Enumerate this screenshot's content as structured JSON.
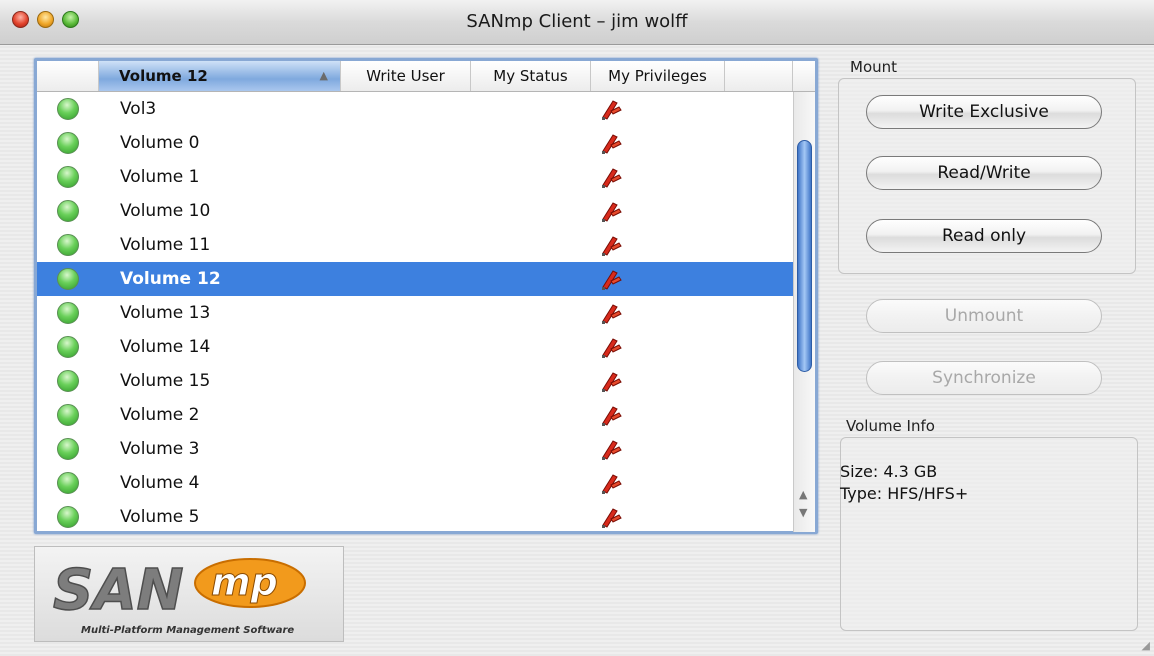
{
  "window": {
    "title": "SANmp Client – jim wolff"
  },
  "table": {
    "columns": {
      "name": "Volume 12",
      "write_user": "Write User",
      "my_status": "My Status",
      "my_privileges": "My Privileges"
    },
    "rows": [
      {
        "name": "Vol3"
      },
      {
        "name": "Volume 0"
      },
      {
        "name": "Volume 1"
      },
      {
        "name": "Volume 10"
      },
      {
        "name": "Volume 11"
      },
      {
        "name": "Volume 12",
        "selected": true
      },
      {
        "name": "Volume 13"
      },
      {
        "name": "Volume 14"
      },
      {
        "name": "Volume 15"
      },
      {
        "name": "Volume 2"
      },
      {
        "name": "Volume 3"
      },
      {
        "name": "Volume 4"
      },
      {
        "name": "Volume 5"
      }
    ]
  },
  "mount": {
    "label": "Mount",
    "write_exclusive": "Write Exclusive",
    "read_write": "Read/Write",
    "read_only": "Read only"
  },
  "actions": {
    "unmount": "Unmount",
    "synchronize": "Synchronize"
  },
  "volume_info": {
    "label": "Volume Info",
    "size": "Size: 4.3 GB",
    "type": "Type: HFS/HFS+"
  },
  "logo": {
    "text_san": "SAN",
    "text_mp": "mp",
    "tagline": "Multi-Platform Management Software"
  },
  "colors": {
    "selection": "#3d80df",
    "status_green": "#6ad05a",
    "logo_orange": "#f29a1c"
  }
}
